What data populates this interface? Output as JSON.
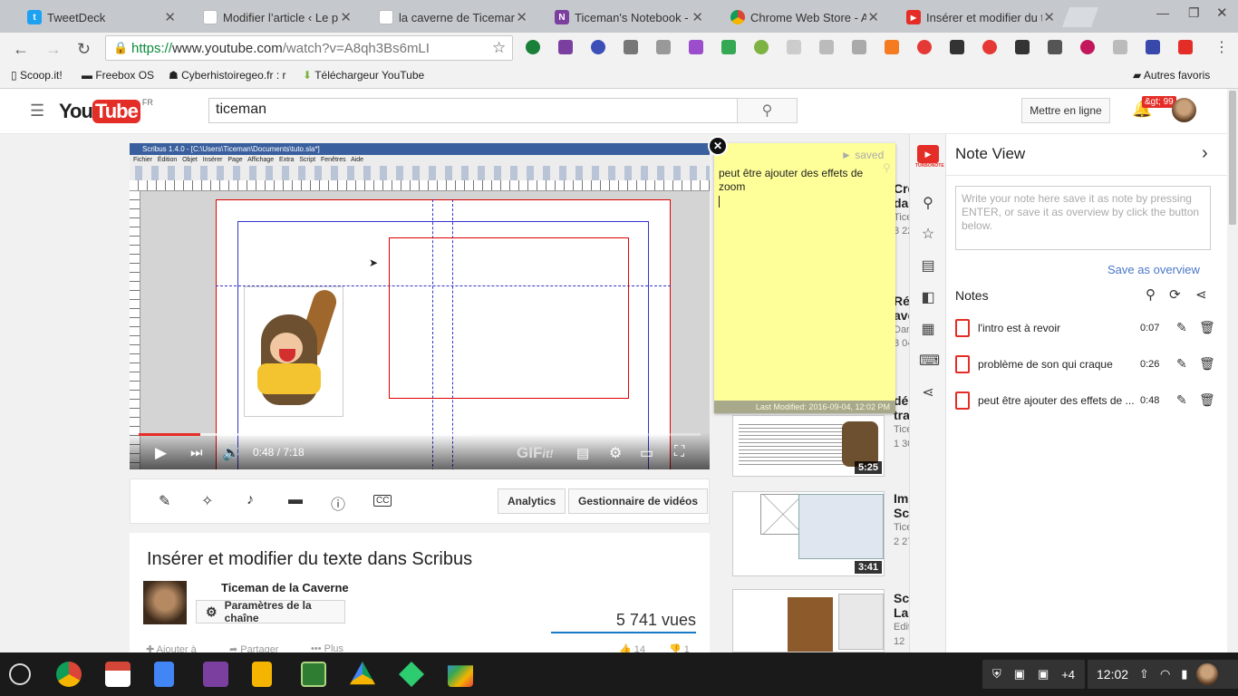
{
  "tabs": [
    {
      "title": "TweetDeck",
      "color": "#1da1f2",
      "glyph": "t"
    },
    {
      "title": "Modifier l’article ‹ Le pro",
      "color": "#e0e0e0",
      "glyph": ""
    },
    {
      "title": "la caverne de Ticeman",
      "color": "#e0e0e0",
      "glyph": ""
    },
    {
      "title": "Ticeman's Notebook - M",
      "color": "#7b3fa0",
      "glyph": "N"
    },
    {
      "title": "Chrome Web Store - App",
      "color": "#e0e0e0",
      "glyph": ""
    },
    {
      "title": "Insérer et modifier du te",
      "color": "#e52d27",
      "glyph": "▶"
    }
  ],
  "url": {
    "scheme": "https://",
    "host": "www.youtube.com",
    "path": "/watch?v=A8qh3Bs6mLI"
  },
  "bookmarks": [
    "Scoop.it!",
    "Freebox OS",
    "Cyberhistoiregeo.fr : r",
    "Téléchargeur YouTube"
  ],
  "other_bookmarks": "Autres favoris",
  "youtube": {
    "country": "FR",
    "search_value": "ticeman",
    "upload_label": "Mettre en ligne",
    "notif_badge": "&gt; 99",
    "time": "0:48 / 7:18",
    "progress": 0.11,
    "buffered": 0.59,
    "gif_label": "GIF",
    "analytics": "Analytics",
    "video_manager": "Gestionnaire de vidéos",
    "video_title": "Insérer et modifier du texte dans Scribus",
    "channel": "Ticeman de la Caverne",
    "channel_settings": "Paramètres de la chaîne",
    "views": "5 741 vues",
    "add_to": "Ajouter à",
    "share": "Partager",
    "more": "Plus",
    "likes": "14",
    "dislikes": "1"
  },
  "scribus": {
    "title": "Scribus 1.4.0 - [C:\\Users\\Ticeman\\Documents\\tuto.sla*]",
    "menu": [
      "Fichier",
      "Édition",
      "Objet",
      "Insérer",
      "Page",
      "Affichage",
      "Extra",
      "Script",
      "Fenêtres",
      "Aide"
    ]
  },
  "related": [
    {
      "title": "Cré",
      "title2": "dar",
      "sub": "Tice",
      "sub2": "3 22"
    },
    {
      "title": "Réa",
      "title2": "ave",
      "sub": "Dan",
      "sub2": "3 04"
    },
    {
      "title": "déc",
      "title2": "tra",
      "sub": "Tice",
      "sub2": "1 30",
      "duration": "5:25"
    },
    {
      "title": "Imp",
      "title2": "Scr",
      "sub": "Tice",
      "sub2": "2 27",
      "duration": "3:41"
    },
    {
      "title": "Scr",
      "title2": "La",
      "sub": "Edit",
      "sub2": "12"
    }
  ],
  "sticky": {
    "saved": "saved",
    "text": "peut être ajouter des effets de zoom",
    "last_modified": "Last Modified: 2016-09-04, 12:02 PM"
  },
  "notes_panel": {
    "brand": "TURBONOTE",
    "title": "Note View",
    "placeholder": "Write your note here save it as note by pressing ENTER, or save it as overview by click the button below.",
    "save_overview": "Save as overview",
    "notes_heading": "Notes",
    "notes": [
      {
        "text": "l'intro est à revoir",
        "time": "0:07"
      },
      {
        "text": "problème de son qui craque",
        "time": "0:26"
      },
      {
        "text": "peut être ajouter des effets de ...",
        "time": "0:48"
      }
    ]
  },
  "shelf": {
    "time": "12:02",
    "badge": "+4"
  },
  "colors": {
    "yt_red": "#e52d27",
    "link_blue": "#4a78c8",
    "sticky": "#ffff99"
  }
}
